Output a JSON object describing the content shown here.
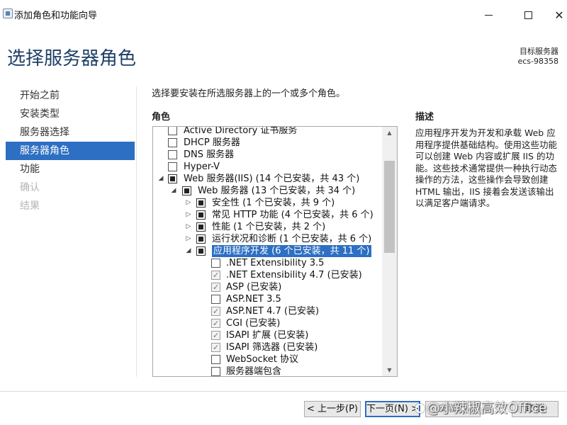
{
  "window": {
    "title": "添加角色和功能向导",
    "minimize_icon": "minimize-icon",
    "maximize_icon": "maximize-icon",
    "close_icon": "close-icon"
  },
  "header": {
    "page_title": "选择服务器角色",
    "target_label": "目标服务器",
    "target_server": "ecs-98358"
  },
  "nav": {
    "items": [
      {
        "label": "开始之前",
        "state": "normal"
      },
      {
        "label": "安装类型",
        "state": "normal"
      },
      {
        "label": "服务器选择",
        "state": "normal"
      },
      {
        "label": "服务器角色",
        "state": "active"
      },
      {
        "label": "功能",
        "state": "normal"
      },
      {
        "label": "确认",
        "state": "disabled"
      },
      {
        "label": "结果",
        "state": "disabled"
      }
    ]
  },
  "main": {
    "instruction": "选择要安装在所选服务器上的一个或多个角色。",
    "roles_header": "角色",
    "description_header": "描述",
    "description_text": "应用程序开发为开发和承载 Web 应用程序提供基础结构。使用这些功能可以创建 Web 内容或扩展 IIS 的功能。这些技术通常提供一种执行动态操作的方法，这些操作会导致创建 HTML 输出，IIS 接着会发送该输出以满足客户端请求。"
  },
  "roles_tree": [
    {
      "label": "Active Directory 证书服务",
      "level": 0,
      "expander": "none",
      "check": "unchecked"
    },
    {
      "label": "DHCP 服务器",
      "level": 0,
      "expander": "none",
      "check": "unchecked"
    },
    {
      "label": "DNS 服务器",
      "level": 0,
      "expander": "none",
      "check": "unchecked"
    },
    {
      "label": "Hyper-V",
      "level": 0,
      "expander": "none",
      "check": "unchecked"
    },
    {
      "label": "Web 服务器(IIS) (14 个已安装，共 43 个)",
      "level": 0,
      "expander": "expanded",
      "check": "partial"
    },
    {
      "label": "Web 服务器 (13 个已安装，共 34 个)",
      "level": 1,
      "expander": "expanded",
      "check": "partial"
    },
    {
      "label": "安全性 (1 个已安装，共 9 个)",
      "level": 2,
      "expander": "collapsed",
      "check": "partial"
    },
    {
      "label": "常见 HTTP 功能 (4 个已安装，共 6 个)",
      "level": 2,
      "expander": "collapsed",
      "check": "partial"
    },
    {
      "label": "性能 (1 个已安装，共 2 个)",
      "level": 2,
      "expander": "collapsed",
      "check": "partial"
    },
    {
      "label": "运行状况和诊断 (1 个已安装，共 6 个)",
      "level": 2,
      "expander": "collapsed",
      "check": "partial"
    },
    {
      "label": "应用程序开发 (6 个已安装，共 11 个)",
      "level": 2,
      "expander": "expanded",
      "check": "partial",
      "selected": true
    },
    {
      "label": ".NET Extensibility 3.5",
      "level": 3,
      "expander": "none",
      "check": "unchecked"
    },
    {
      "label": ".NET Extensibility 4.7 (已安装)",
      "level": 3,
      "expander": "none",
      "check": "checked"
    },
    {
      "label": "ASP (已安装)",
      "level": 3,
      "expander": "none",
      "check": "checked"
    },
    {
      "label": "ASP.NET 3.5",
      "level": 3,
      "expander": "none",
      "check": "unchecked"
    },
    {
      "label": "ASP.NET 4.7 (已安装)",
      "level": 3,
      "expander": "none",
      "check": "checked"
    },
    {
      "label": "CGI (已安装)",
      "level": 3,
      "expander": "none",
      "check": "checked"
    },
    {
      "label": "ISAPI 扩展 (已安装)",
      "level": 3,
      "expander": "none",
      "check": "checked"
    },
    {
      "label": "ISAPI 筛选器 (已安装)",
      "level": 3,
      "expander": "none",
      "check": "checked"
    },
    {
      "label": "WebSocket 协议",
      "level": 3,
      "expander": "none",
      "check": "unchecked"
    },
    {
      "label": "服务器端包含",
      "level": 3,
      "expander": "none",
      "check": "unchecked"
    }
  ],
  "footer": {
    "prev_label": "< 上一步(P)",
    "next_label": "下一页(N) >",
    "install_label": "安装(I)",
    "cancel_label": "取消"
  },
  "watermark": {
    "text": "@小辣椒高效Office"
  },
  "colors": {
    "accent": "#2d6fc2",
    "title_text": "#1e3f66",
    "disabled_text": "#b5b5b5"
  }
}
